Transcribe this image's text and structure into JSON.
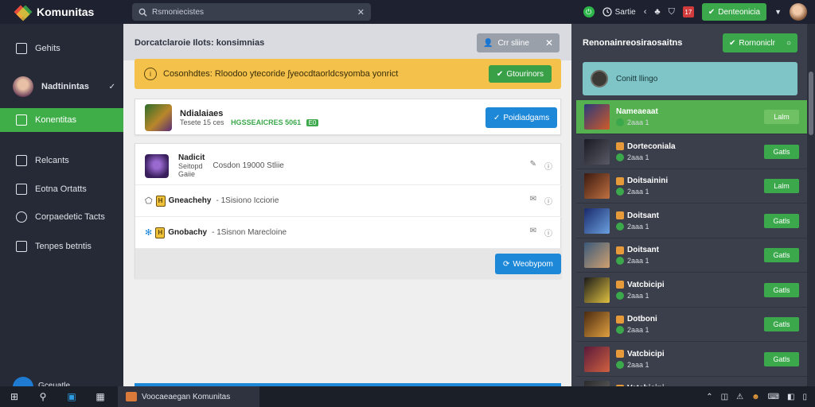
{
  "app": {
    "title": "Komunitas"
  },
  "search": {
    "text": "Rsmoniecistes"
  },
  "topbar": {
    "status_label": "Sartie",
    "action_button": "Denteonicia"
  },
  "sidebar": {
    "items": [
      {
        "label": "Gehits",
        "icon": "calendar-icon"
      },
      {
        "label": "Nadtinintas",
        "icon": "avatar"
      },
      {
        "label": "Konentitas",
        "icon": "chat-icon"
      },
      {
        "label": "Relcants",
        "icon": "document-icon"
      },
      {
        "label": "Eotna Ortatts",
        "icon": "calendar-icon"
      },
      {
        "label": "Corpaedetic Tacts",
        "icon": "gear-icon"
      },
      {
        "label": "Tenpes betntis",
        "icon": "list-icon"
      }
    ],
    "bottom_label": "Gceuatle"
  },
  "main": {
    "title": "Dorcatclaroie Ilots: konsimnias",
    "header_button": "Crr sliine",
    "alert": {
      "text": "Cosonhdtes: Rloodoo ytecoride ʃyeocdtaorldcsyomba yonrict",
      "button": "Gtourinors"
    },
    "featured": {
      "title": "Ndialaiaes",
      "subtitle": "Tesete 15 ces",
      "highlight": "HGSSEAICRES 5061",
      "tag": "E0",
      "button": "Poidiadgams"
    },
    "rows": [
      {
        "name": "Nadicit",
        "line2": "Seitopd",
        "line3": "Gaiie",
        "detail": "Cosdon 19000 Stliie"
      },
      {
        "name": "Gneachehy",
        "detail": "- 1Sisiono Icciorie"
      },
      {
        "name": "Gnobachy",
        "detail": "- 1Sisnon Marecloine"
      }
    ],
    "footer_button": "Weobypom"
  },
  "right": {
    "title": "Renonainreosiraosaitns",
    "top_button": "Rornoniclr",
    "search_label": "Conitt llingo",
    "friends": [
      {
        "name": "Nameaeaat",
        "sub": "2aaa 1",
        "action": "Lalm",
        "active": true
      },
      {
        "name": "Dorteconiala",
        "sub": "2aaa 1",
        "action": "Gatls",
        "active": false
      },
      {
        "name": "Doitsainini",
        "sub": "2aaa 1",
        "action": "Lalm",
        "active": false
      },
      {
        "name": "Doitsant",
        "sub": "2aaa 1",
        "action": "Gatls",
        "active": false
      },
      {
        "name": "Doitsant",
        "sub": "2aaa 1",
        "action": "Gatls",
        "active": false
      },
      {
        "name": "Vatcbicipi",
        "sub": "2aaa 1",
        "action": "Gatls",
        "active": false
      },
      {
        "name": "Dotboni",
        "sub": "2aaa 1",
        "action": "Gatls",
        "active": false
      },
      {
        "name": "Vatcbicipi",
        "sub": "2aaa 1",
        "action": "Gatls",
        "active": false
      },
      {
        "name": "Vatcbicipi",
        "sub": "",
        "action": "",
        "active": false
      }
    ]
  },
  "taskbar": {
    "app_label": "Voocaeaegan Komunitas"
  },
  "colors": {
    "accent_green": "#3fae49",
    "alert_yellow": "#f4c24b",
    "primary_blue": "#1e88d8",
    "sidebar_bg": "#252a36"
  }
}
